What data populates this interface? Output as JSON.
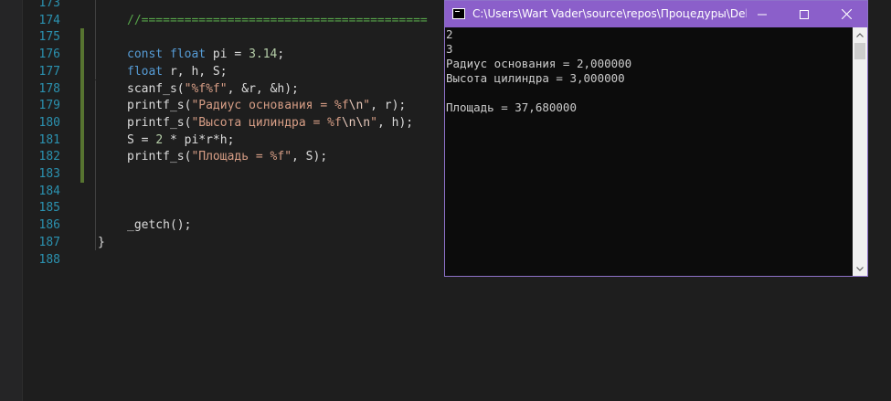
{
  "editor": {
    "lines": [
      {
        "num": "173",
        "tokens": []
      },
      {
        "num": "174",
        "tokens": [
          {
            "cls": "cmt",
            "text": "//========================================"
          }
        ]
      },
      {
        "num": "175",
        "tokens": []
      },
      {
        "num": "176",
        "tokens": [
          {
            "cls": "kw",
            "text": "const"
          },
          {
            "cls": "",
            "text": " "
          },
          {
            "cls": "kw",
            "text": "float"
          },
          {
            "cls": "",
            "text": " pi = "
          },
          {
            "cls": "num",
            "text": "3.14"
          },
          {
            "cls": "",
            "text": ";"
          }
        ]
      },
      {
        "num": "177",
        "tokens": [
          {
            "cls": "kw",
            "text": "float"
          },
          {
            "cls": "",
            "text": " r, h, S;"
          }
        ]
      },
      {
        "num": "178",
        "tokens": [
          {
            "cls": "",
            "text": "scanf_s("
          },
          {
            "cls": "str",
            "text": "\"%f%f\""
          },
          {
            "cls": "",
            "text": ", &r, &h);"
          }
        ]
      },
      {
        "num": "179",
        "tokens": [
          {
            "cls": "",
            "text": "printf_s("
          },
          {
            "cls": "str",
            "text": "\"Радиус основания = %f"
          },
          {
            "cls": "esc",
            "text": "\\n"
          },
          {
            "cls": "str",
            "text": "\""
          },
          {
            "cls": "",
            "text": ", r);"
          }
        ]
      },
      {
        "num": "180",
        "tokens": [
          {
            "cls": "",
            "text": "printf_s("
          },
          {
            "cls": "str",
            "text": "\"Высота цилиндра = %f"
          },
          {
            "cls": "esc",
            "text": "\\n\\n"
          },
          {
            "cls": "str",
            "text": "\""
          },
          {
            "cls": "",
            "text": ", h);"
          }
        ]
      },
      {
        "num": "181",
        "tokens": [
          {
            "cls": "",
            "text": "S = "
          },
          {
            "cls": "num",
            "text": "2"
          },
          {
            "cls": "",
            "text": " * pi*r*h;"
          }
        ]
      },
      {
        "num": "182",
        "tokens": [
          {
            "cls": "",
            "text": "printf_s("
          },
          {
            "cls": "str",
            "text": "\"Площадь = %f\""
          },
          {
            "cls": "",
            "text": ", S);"
          }
        ]
      },
      {
        "num": "183",
        "tokens": []
      },
      {
        "num": "184",
        "tokens": []
      },
      {
        "num": "185",
        "tokens": []
      },
      {
        "num": "186",
        "tokens": [
          {
            "cls": "",
            "text": "_getch();"
          }
        ]
      },
      {
        "num": "187",
        "tokens": [
          {
            "cls": "",
            "text": "}"
          }
        ],
        "brace": true
      },
      {
        "num": "188",
        "tokens": []
      }
    ],
    "changed_lines": [
      "175",
      "176",
      "177",
      "178",
      "179",
      "180",
      "181",
      "182",
      "183"
    ]
  },
  "console": {
    "title": "C:\\Users\\Wart Vader\\source\\repos\\Процедуры\\Debu...",
    "output": [
      "2",
      "3",
      "Радиус основания = 2,000000",
      "Высота цилиндра = 3,000000",
      "",
      "Площадь = 37,680000"
    ],
    "icons": {
      "app": "console-app-icon",
      "minimize": "minimize-icon",
      "maximize": "maximize-icon",
      "close": "close-icon",
      "scroll_up": "scroll-up-icon",
      "scroll_down": "scroll-down-icon"
    }
  },
  "colors": {
    "editor_bg": "#1e1e1e",
    "line_number": "#2b91af",
    "keyword": "#569cd6",
    "string": "#d69d85",
    "comment": "#57a64a",
    "console_title_bg": "#8b5fca",
    "console_bg": "#0c0c0c",
    "change_marker": "#577430"
  }
}
